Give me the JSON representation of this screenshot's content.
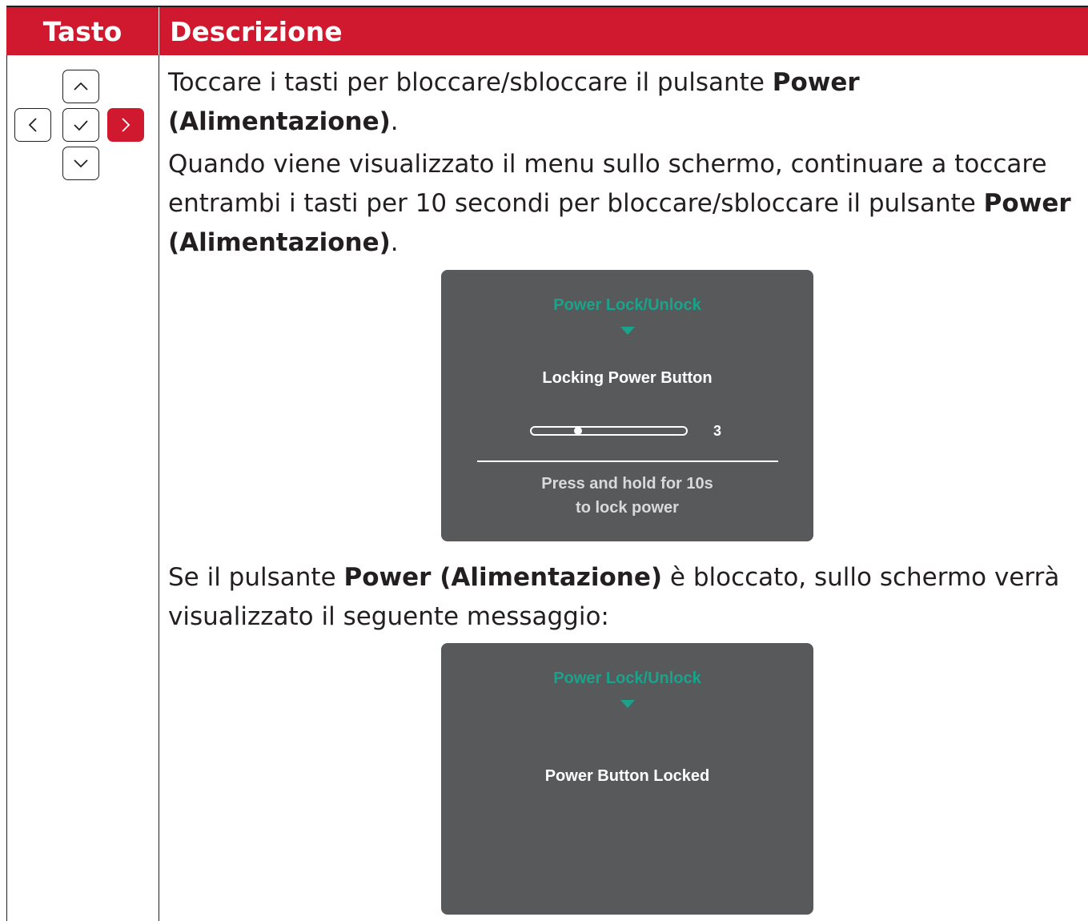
{
  "table": {
    "header": {
      "key": "Tasto",
      "description": "Descrizione"
    }
  },
  "row": {
    "keys": [
      {
        "id": "up",
        "icon": "chevron-up-icon",
        "active": false
      },
      {
        "id": "left",
        "icon": "chevron-left-icon",
        "active": false
      },
      {
        "id": "ok",
        "icon": "check-icon",
        "active": false
      },
      {
        "id": "right",
        "icon": "chevron-right-icon",
        "active": true
      },
      {
        "id": "down",
        "icon": "chevron-down-icon",
        "active": false
      }
    ],
    "paragraph1": {
      "before": "Toccare i tasti per bloccare/sbloccare il pulsante ",
      "bold": "Power (Alimentazione)",
      "after": "."
    },
    "paragraph2": {
      "before": "Quando viene visualizzato il menu sullo schermo, continuare a toccare entrambi i tasti per 10 secondi per bloccare/sbloccare il pulsante ",
      "bold": "Power (Alimentazione)",
      "after": "."
    },
    "paragraph3": {
      "before": "Se il pulsante ",
      "bold": "Power (Alimentazione)",
      "after": " è bloccato, sullo schermo verrà visualizzato il seguente messaggio:"
    }
  },
  "osd_locking": {
    "title": "Power Lock/Unlock",
    "message": "Locking Power Button",
    "countdown": "3",
    "progress_fraction": 0.3,
    "hint_line1": "Press and hold for 10s",
    "hint_line2": "to lock power"
  },
  "osd_locked": {
    "title": "Power Lock/Unlock",
    "message": "Power Button Locked"
  },
  "colors": {
    "header_red": "#d0192e",
    "osd_background": "#58595b",
    "osd_accent_teal": "#1aa38b",
    "text": "#231f20"
  }
}
